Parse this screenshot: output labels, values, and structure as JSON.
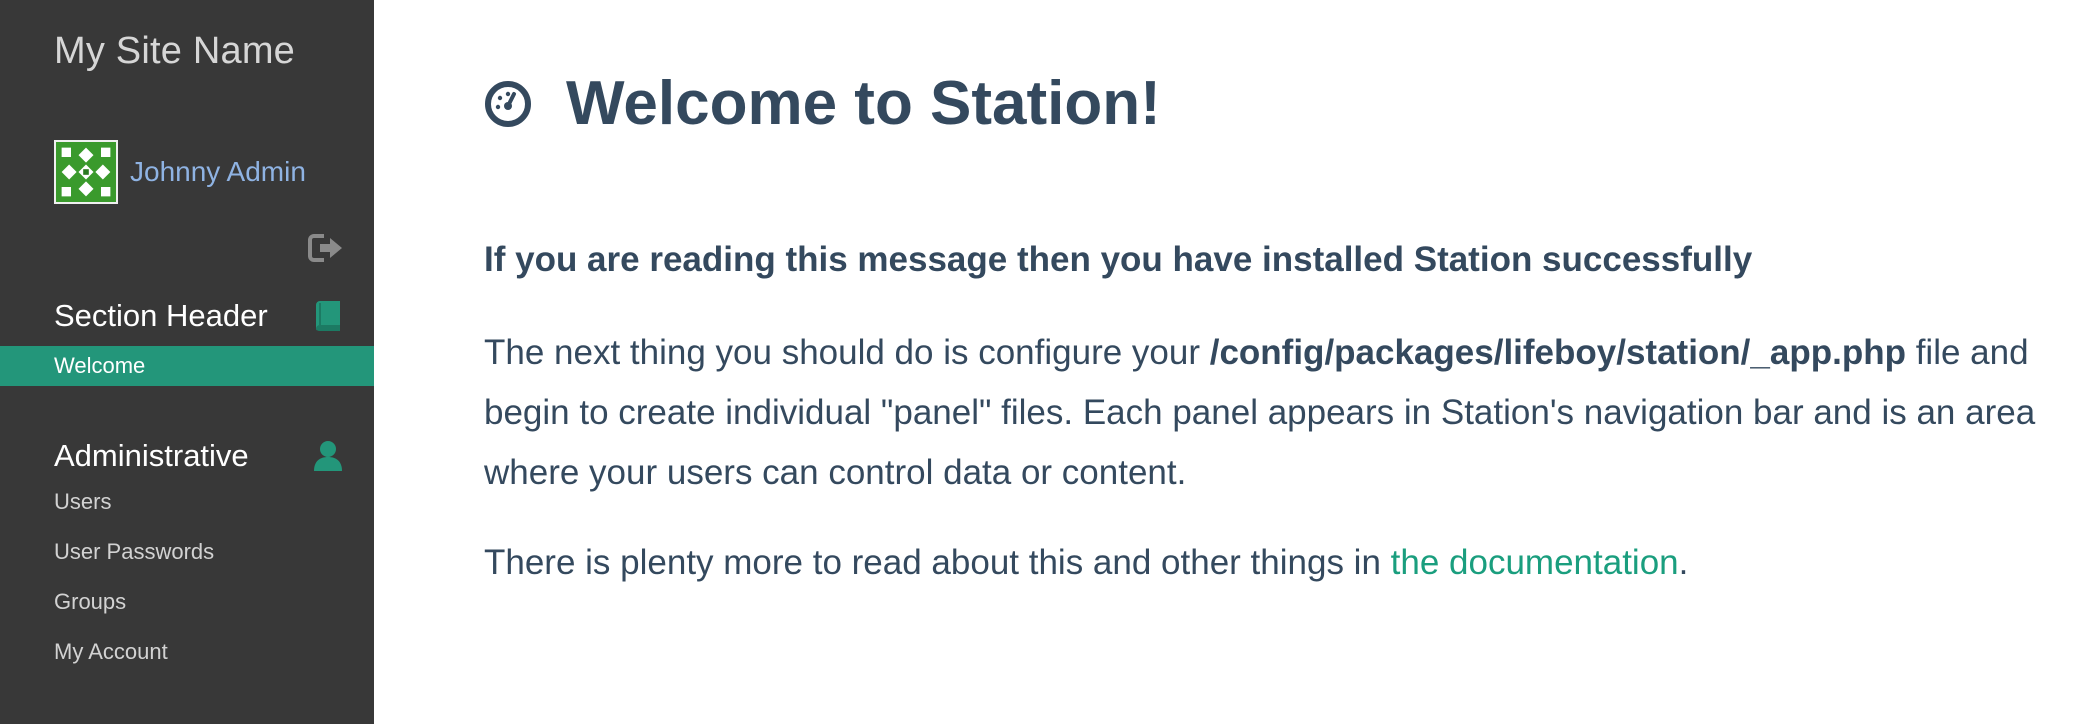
{
  "sidebar": {
    "site_name": "My Site Name",
    "user_name": "Johnny Admin",
    "sections": [
      {
        "header": "Section Header",
        "icon": "book-icon",
        "items": [
          {
            "label": "Welcome",
            "active": true
          }
        ]
      },
      {
        "header": "Administrative",
        "icon": "user-icon",
        "items": [
          {
            "label": "Users"
          },
          {
            "label": "User Passwords"
          },
          {
            "label": "Groups"
          },
          {
            "label": "My Account"
          }
        ]
      }
    ]
  },
  "main": {
    "title": "Welcome to Station!",
    "title_icon": "dashboard-icon",
    "lead": "If you are reading this message then you have installed Station successfully",
    "p1": {
      "before": "The next thing you should do is configure your ",
      "path": "/config/packages/lifeboy/station/_app.php",
      "after_line1": " file and",
      "line2": "begin to create individual \"panel\" files. Each panel appears in Station's navigation bar and is an area",
      "line3": "where your users can control data or content."
    },
    "p2": {
      "before": "There is plenty more to read about this and other things in ",
      "link": "the documentation",
      "after": "."
    }
  },
  "colors": {
    "sidebar_bg": "#383838",
    "accent": "#23967a",
    "text": "#34495e",
    "link": "#1a9e7e",
    "user_link": "#8fb3e3"
  }
}
